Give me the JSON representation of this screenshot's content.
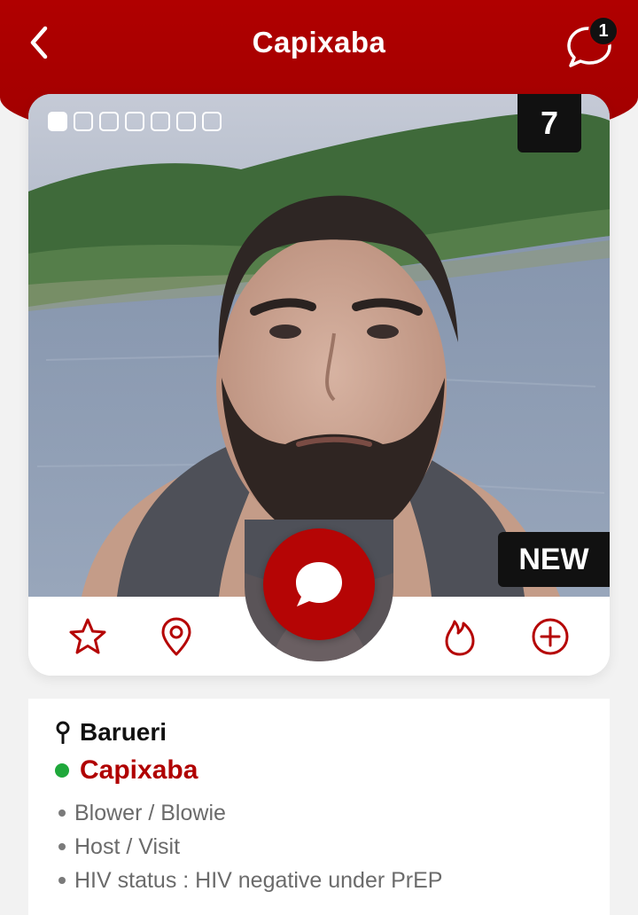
{
  "header": {
    "title": "Capixaba",
    "chat_badge_count": "1",
    "back_icon": "chevron-left-icon",
    "chat_icon": "chat-bubble-icon",
    "color": "#b00000"
  },
  "profile": {
    "photo_count": "7",
    "photo_pages_total": 7,
    "photo_page_active": 1,
    "new_badge": "NEW",
    "location": "Barueri",
    "name": "Capixaba",
    "online": true,
    "online_color": "#1fa83b",
    "tags": [
      "Blower / Blowie",
      "Host / Visit",
      "HIV status : HIV negative under PrEP"
    ]
  },
  "actions": {
    "favorite_icon": "star-icon",
    "location_icon": "map-pin-icon",
    "message_icon": "chat-bubble-icon",
    "hot_icon": "flame-icon",
    "add_icon": "plus-circle-icon",
    "accent": "#b50505"
  }
}
